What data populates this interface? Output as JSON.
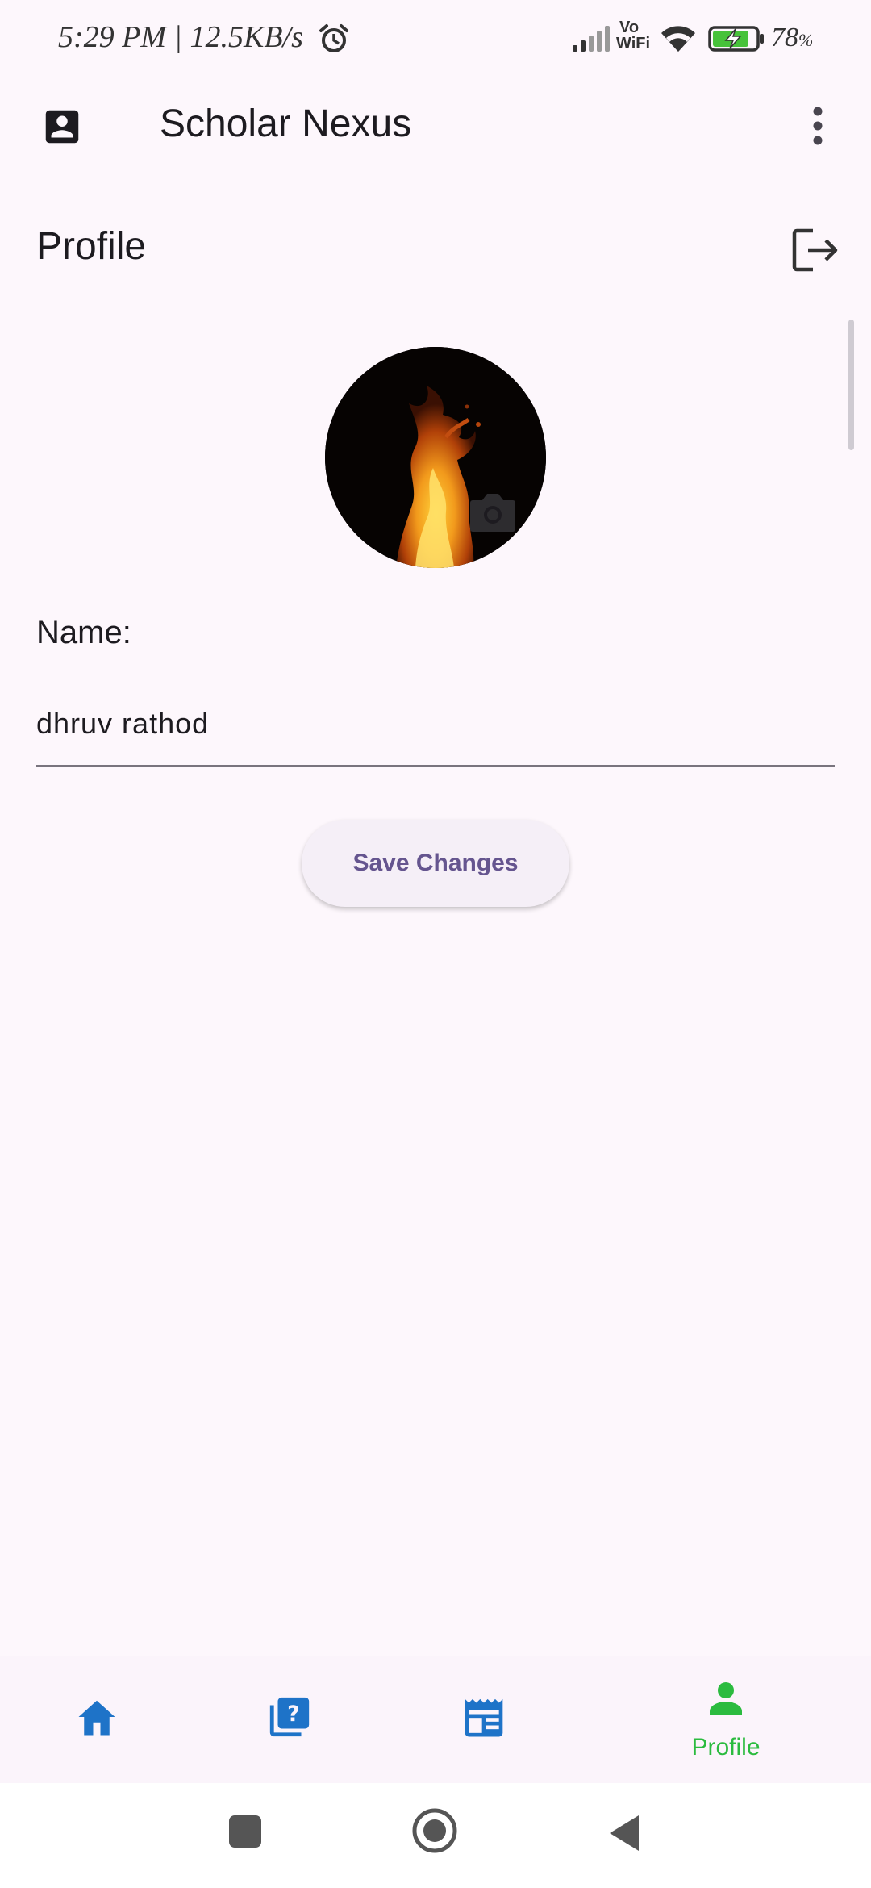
{
  "status_bar": {
    "time_text": "5:29 PM | 12.5KB/s",
    "battery_percent": "78",
    "battery_unit": "%",
    "vowifi_top": "Vo",
    "vowifi_bottom": "WiFi"
  },
  "app_bar": {
    "title": "Scholar Nexus",
    "leading_icon": "account-box-icon",
    "menu_icon": "more-vert-icon"
  },
  "page": {
    "title": "Profile",
    "logout_icon": "logout-icon"
  },
  "profile": {
    "avatar": "fire-photo",
    "name_label": "Name:",
    "name_value": "dhruv rathod",
    "save_label": "Save Changes"
  },
  "bottom_nav": {
    "items": [
      {
        "icon": "home-icon",
        "label": ""
      },
      {
        "icon": "question-library-icon",
        "label": ""
      },
      {
        "icon": "newspaper-icon",
        "label": ""
      },
      {
        "icon": "person-icon",
        "label": "Profile"
      }
    ],
    "selected_index": 3,
    "colors": {
      "inactive": "#1e73c8",
      "active": "#2bbb3f"
    }
  },
  "system_nav": {
    "buttons": [
      "recents-icon",
      "home-circle-icon",
      "back-icon"
    ]
  }
}
